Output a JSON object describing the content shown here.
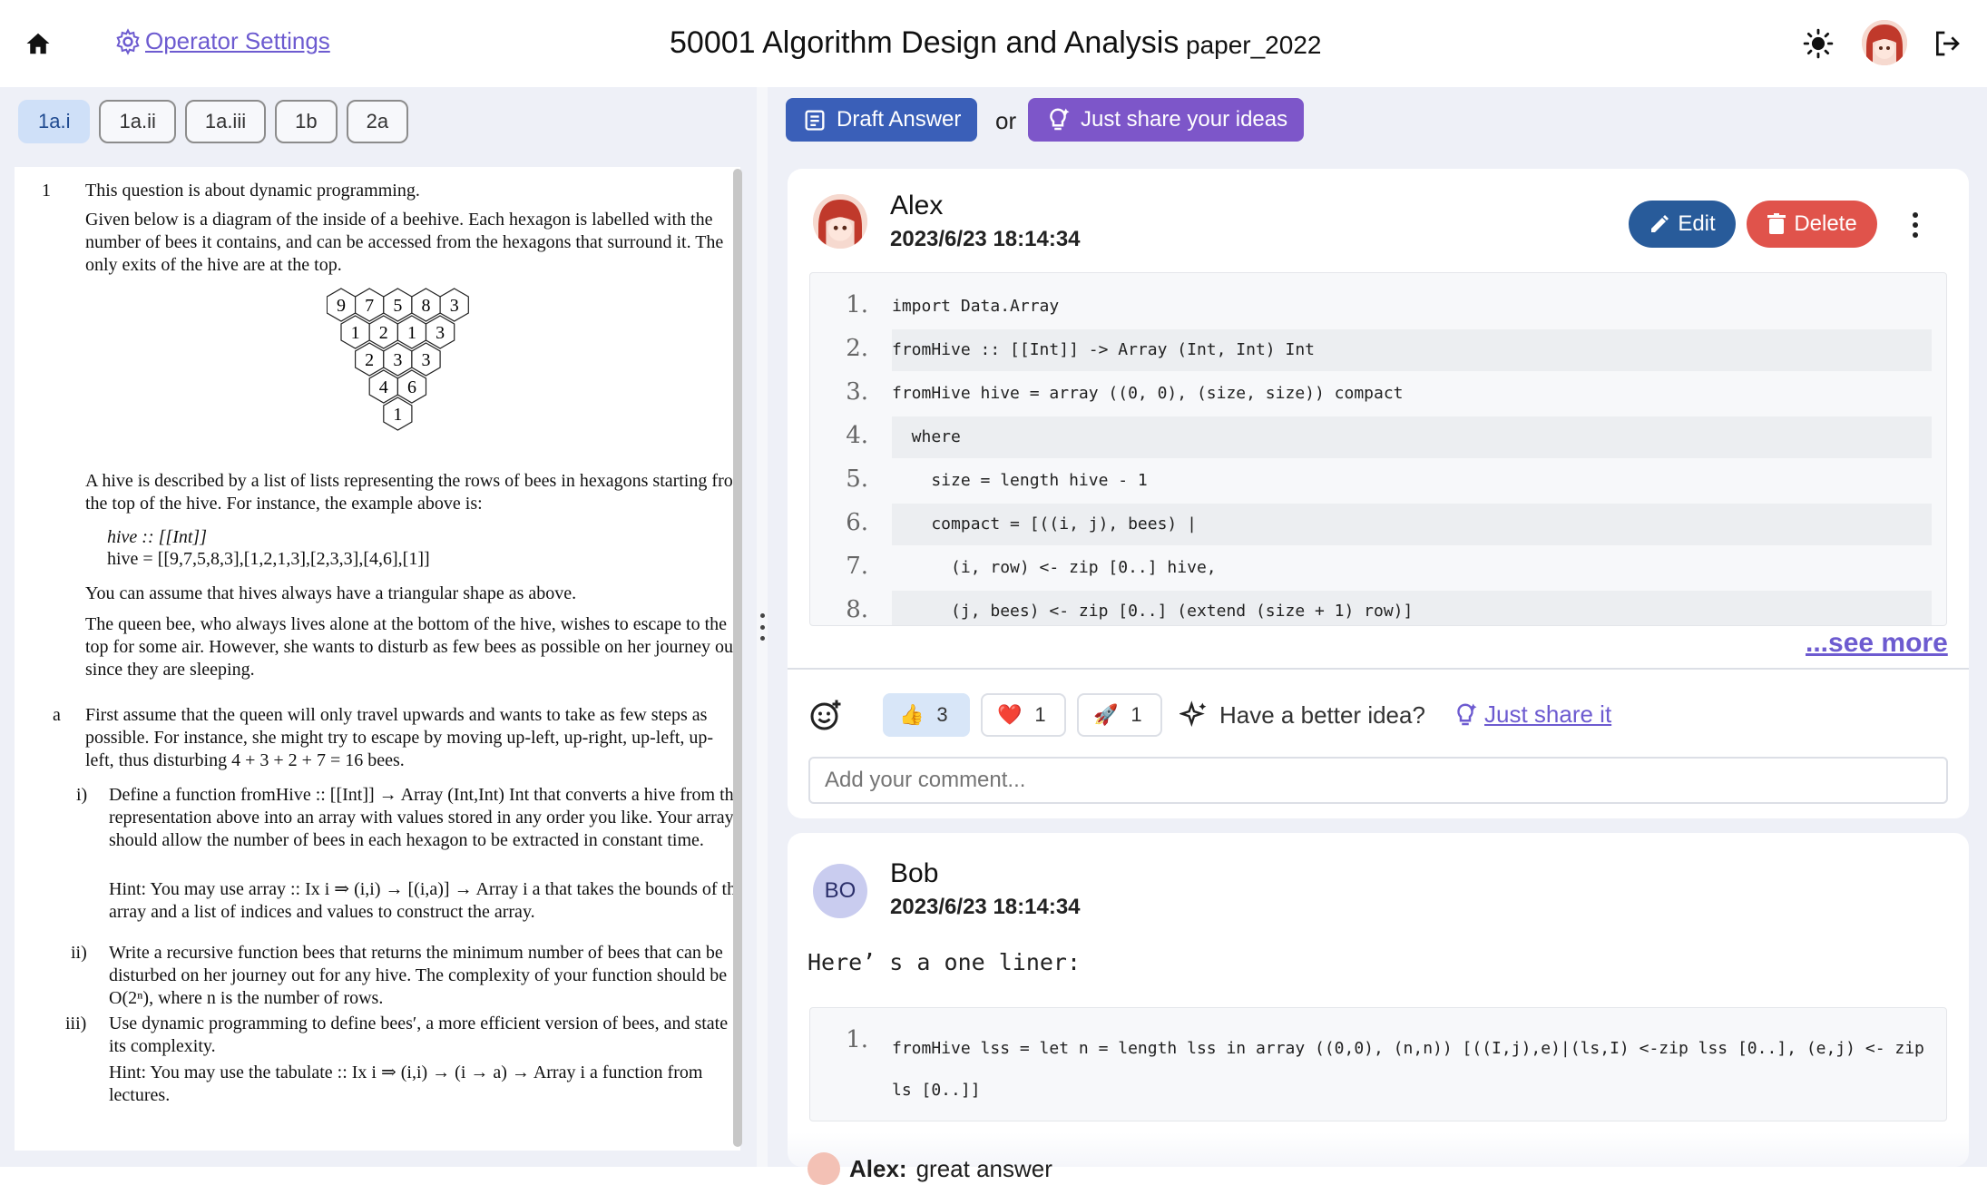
{
  "header": {
    "settings_label": "Operator Settings",
    "title": "50001 Algorithm Design and Analysis",
    "paper": "paper_2022",
    "icons": [
      "home-icon",
      "gear-icon",
      "sun-icon",
      "avatar",
      "logout-icon"
    ]
  },
  "question_tabs": [
    "1a.i",
    "1a.ii",
    "1a.iii",
    "1b",
    "2a"
  ],
  "active_tab": "1a.i",
  "paper": {
    "q_number": "1",
    "intro": "This question is about dynamic programming.",
    "para1": "Given below is a diagram of the inside of a beehive. Each hexagon is labelled with the number of bees it contains, and can be accessed from the hexagons that surround it. The only exits of the hive are at the top.",
    "hive_rows": [
      [
        9,
        7,
        5,
        8,
        3
      ],
      [
        1,
        2,
        1,
        3
      ],
      [
        2,
        3,
        3
      ],
      [
        4,
        6
      ],
      [
        1
      ]
    ],
    "para2": "A hive is described by a list of lists representing the rows of bees in hexagons starting from the top of the hive. For instance, the example above is:",
    "code_type": "hive :: [[Int]]",
    "code_value": "hive = [[9,7,5,8,3],[1,2,1,3],[2,3,3],[4,6],[1]]",
    "para3": "You can assume that hives always have a triangular shape as above.",
    "para4": "The queen bee, who always lives alone at the bottom of the hive, wishes to escape to the top for some air. However, she wants to disturb as few bees as possible on her journey out, since they are sleeping.",
    "part_a_label": "a",
    "part_a": "First assume that the queen will only travel upwards and wants to take as few steps as possible. For instance, she might try to escape by moving up-left, up-right, up-left, up-left, thus disturbing 4 + 3 + 2 + 7 = 16 bees.",
    "i_label": "i)",
    "i_text": "Define a function fromHive :: [[Int]] → Array (Int,Int) Int that converts a hive from the representation above into an array with values stored in any order you like. Your array should allow the number of bees in each hexagon to be extracted in constant time.",
    "i_hint": "Hint: You may use array :: Ix i ⇒ (i,i) → [(i,a)] → Array i a that takes the bounds of the array and a list of indices and values to construct the array.",
    "ii_label": "ii)",
    "ii_text": "Write a recursive function bees that returns the minimum number of bees that can be disturbed on her journey out for any hive. The complexity of your function should be O(2ⁿ), where n is the number of rows.",
    "iii_label": "iii)",
    "iii_text": "Use dynamic programming to define bees′, a more efficient version of bees, and state its complexity.",
    "iii_hint": "Hint: You may use the tabulate :: Ix i ⇒ (i,i) → (i → a) → Array i a function from lectures."
  },
  "actions": {
    "draft_label": "Draft Answer",
    "or_label": "or",
    "share_label": "Just share your ideas"
  },
  "answer1": {
    "author": "Alex",
    "date": "2023/6/23 18:14:34",
    "edit_label": "Edit",
    "delete_label": "Delete",
    "code": [
      {
        "n": "1.",
        "text": "import Data.Array"
      },
      {
        "n": "2.",
        "text": "fromHive :: [[Int]] -> Array (Int, Int) Int"
      },
      {
        "n": "3.",
        "text": "fromHive hive = array ((0, 0), (size, size)) compact"
      },
      {
        "n": "4.",
        "text": "  where"
      },
      {
        "n": "5.",
        "text": "    size = length hive - 1"
      },
      {
        "n": "6.",
        "text": "    compact = [((i, j), bees) |"
      },
      {
        "n": "7.",
        "text": "      (i, row) <- zip [0..] hive,"
      },
      {
        "n": "8.",
        "text": "      (j, bees) <- zip [0..] (extend (size + 1) row)]"
      }
    ],
    "see_more": "...see more",
    "reactions": [
      {
        "emoji": "👍",
        "count": "3"
      },
      {
        "emoji": "❤️",
        "count": "1"
      },
      {
        "emoji": "🚀",
        "count": "1"
      }
    ],
    "better_idea": "Have a better idea?",
    "share_it": "Just share it",
    "comment_placeholder": "Add your comment..."
  },
  "answer2": {
    "initials": "BO",
    "author": "Bob",
    "date": "2023/6/23 18:14:34",
    "body": "Here’ s a one liner:",
    "code_n": "1.",
    "code": "fromHive lss = let n = length lss in array ((0,0), (n,n)) [((I,j),e)|(ls,I) <-zip lss [0..], (e,j) <- zip ls [0..]]"
  },
  "peek": {
    "author": "Alex:",
    "text": "great answer"
  }
}
